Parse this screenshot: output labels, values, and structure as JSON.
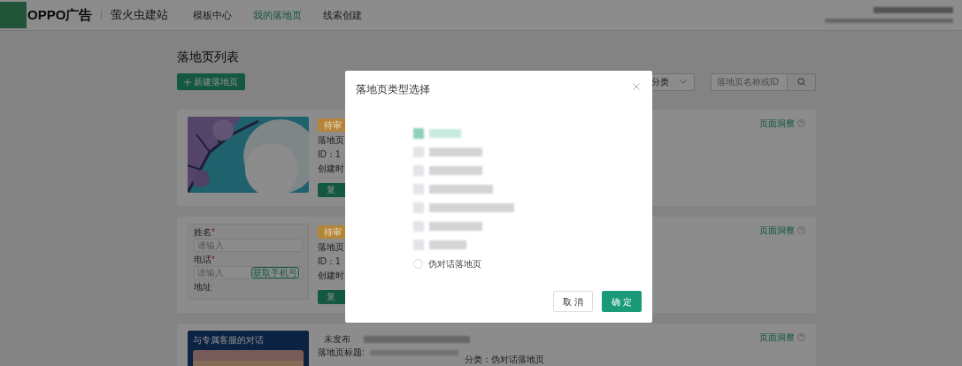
{
  "header": {
    "brand": "OPPO广告",
    "product": "萤火虫建站",
    "nav": [
      {
        "label": "模板中心",
        "selected": false
      },
      {
        "label": "我的落地页",
        "selected": true
      },
      {
        "label": "线索创建",
        "selected": false
      }
    ]
  },
  "page": {
    "title": "落地页列表",
    "new_button": "新建落地页",
    "category_select": "分类",
    "search": {
      "placeholder": "落地页名称或ID"
    }
  },
  "cards": [
    {
      "status": "待审",
      "color": "#b5863a",
      "lines": [
        "落地页",
        "ID：1",
        "创建时"
      ],
      "action": "复",
      "insight": "页面洞察"
    },
    {
      "kind": "form",
      "form": {
        "fields": [
          {
            "label": "姓名",
            "required_mark": "*",
            "placeholder": "请输入"
          },
          {
            "label": "电话",
            "required_mark": "*",
            "placeholder": "请输入",
            "button": "获取手机号"
          }
        ],
        "next_label": "地址"
      },
      "status": "待审",
      "color": "#b5863a",
      "lines": [
        "落地页",
        "ID：1",
        "创建时"
      ],
      "action": "复",
      "insight": "页面洞察"
    },
    {
      "kind": "chat",
      "chat_title": "与专属客服的对话",
      "status": "未发布",
      "color": "#8c8c8c",
      "lines": [
        "落地页标题:"
      ],
      "category": "分类：伪对话落地页",
      "insight": "页面洞察"
    }
  ],
  "dialog": {
    "title": "落地页类型选择",
    "options": [
      {
        "kind": "redacted",
        "selected": true
      },
      {
        "kind": "redacted",
        "selected": false
      },
      {
        "kind": "redacted",
        "selected": false
      },
      {
        "kind": "redacted",
        "selected": false
      },
      {
        "kind": "redacted",
        "selected": false
      },
      {
        "kind": "redacted",
        "selected": false
      },
      {
        "kind": "redacted",
        "selected": false
      },
      {
        "kind": "labeled",
        "label": "伪对话落地页",
        "selected": false
      }
    ],
    "buttons": [
      {
        "kind": "cancel",
        "label": "取 消"
      },
      {
        "kind": "ok",
        "label": "确 定"
      }
    ]
  }
}
